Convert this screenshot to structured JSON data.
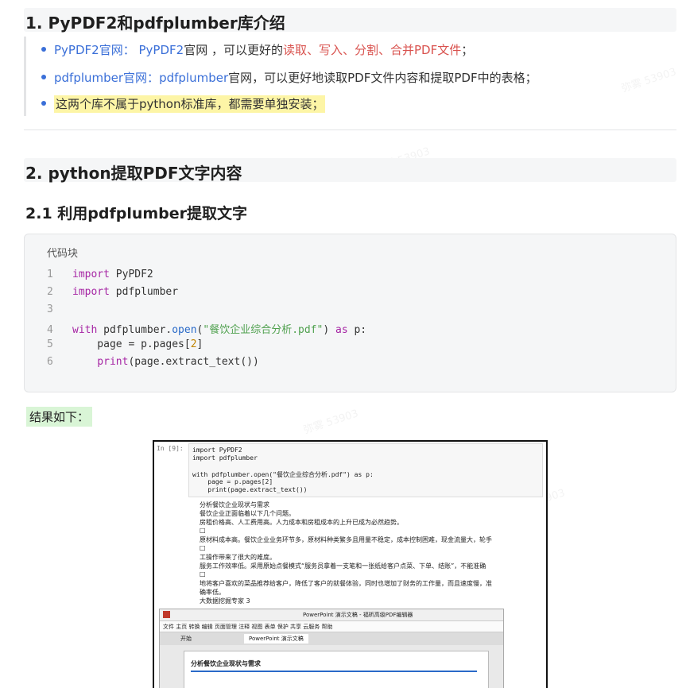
{
  "section1": {
    "heading": "1. PyPDF2和pdfplumber库介绍",
    "items": [
      {
        "a": "PyPDF2官网：",
        "b": "PyPDF2",
        "c": "官网 ，可以更好的",
        "d": "读取、写入、分割、合并PDF文件",
        "e": "；"
      },
      {
        "a": "pdfplumber官网：",
        "b": "pdfplumber",
        "c": "官网，可以更好地读取PDF文件内容和提取PDF中的表格；"
      },
      {
        "text": "这两个库不属于python标准库，都需要单独安装；"
      }
    ]
  },
  "section2": {
    "heading": "2. python提取PDF文字内容",
    "sub": "2.1 利用pdfplumber提取文字",
    "code_label": "代码块",
    "code": {
      "l1_num": "1",
      "l1_kw": "import",
      "l1_rest": " PyPDF2",
      "l2_num": "2",
      "l2_kw": "import",
      "l2_rest": " pdfplumber",
      "l3_num": "3",
      "l4_num": "4",
      "l4_kw": "with",
      "l4_a": " pdfplumber.",
      "l4_fn": "open",
      "l4_b": "(",
      "l4_str": "\"餐饮企业综合分析.pdf\"",
      "l4_c": ") ",
      "l4_as": "as",
      "l4_d": " p:",
      "l5_num": "5",
      "l5_a": "    page = p.pages[",
      "l5_n": "2",
      "l5_b": "]",
      "l6_num": "6",
      "l6_fn": "    print",
      "l6_rest": "(page.extract_text())"
    },
    "result_label": "结果如下："
  },
  "screenshot": {
    "in_label": "In  [9]:",
    "code_lines": [
      "import PyPDF2",
      "import pdfplumber",
      "",
      "with pdfplumber.open(\"餐饮企业综合分析.pdf\") as p:",
      "    page = p.pages[2]",
      "    print(page.extract_text())"
    ],
    "output_lines": [
      "分析餐饮企业现状与需求",
      "餐饮企业正面临着以下几个问题。",
      "房租价格高、人工费用高。人力成本和房租成本的上升已成为必然趋势。",
      "□",
      "原材料成本高。餐饮企业业务环节多，原材料种类繁多且用量不稳定，成本控制困难，现金流量大，轮手",
      "□",
      "工操作带来了很大的难度。",
      "服务工作效率低。采用原始点餐模式“服务员拿着一支笔和一张纸给客户点菜、下单、结账”，不能准确",
      "□",
      "地将客户喜欢的菜品推荐给客户，降低了客户的就餐体验，同时也增加了财务的工作量，而且速度慢，准",
      "确率低。",
      "大数据挖掘专家 3"
    ],
    "app_title": "PowerPoint 演示文稿 - 福昕高级PDF编辑器",
    "menu": "文件  主页  转换  编辑  页面管理  注释  视图  表单  保护  共享  云服务  帮助",
    "tab_start": "开始",
    "tab_doc": "PowerPoint 演示文稿",
    "doc_heading": "分析餐饮企业现状与需求"
  }
}
